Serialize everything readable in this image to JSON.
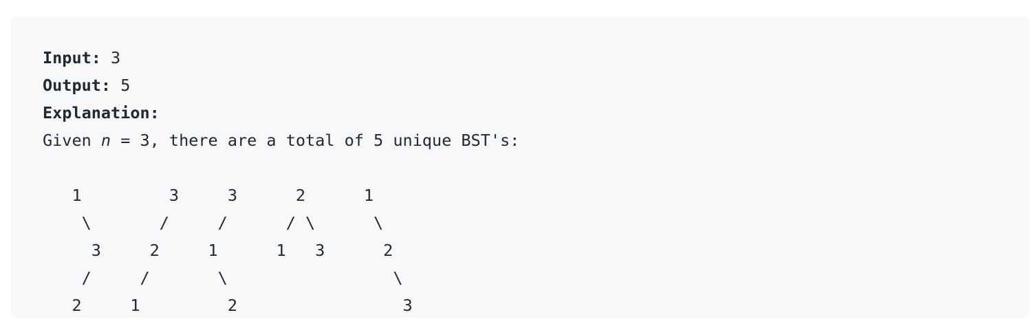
{
  "example": {
    "input_label": "Input:",
    "input_value": " 3",
    "output_label": "Output:",
    "output_value": " 5",
    "explanation_label": "Explanation:",
    "given_prefix": "Given ",
    "given_var": "n",
    "given_suffix": " = 3, there are a total of 5 unique BST's:",
    "tree_lines": [
      "",
      "   1         3     3      2      1",
      "    \\       /     /      / \\      \\",
      "     3     2     1      1   3      2",
      "    /     /       \\                 \\",
      "   2     1         2                 3"
    ]
  }
}
